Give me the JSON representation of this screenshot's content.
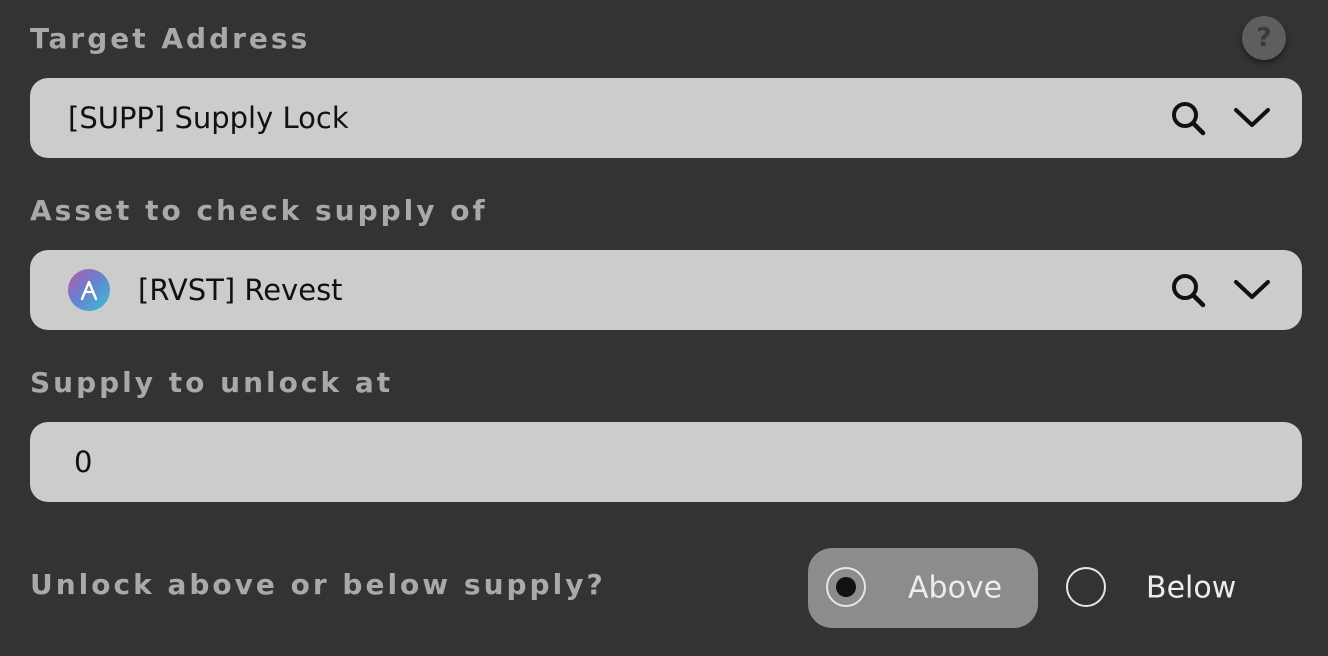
{
  "target_address": {
    "label": "Target Address",
    "value": "[SUPP] Supply Lock",
    "search_icon": "search-icon",
    "dropdown_icon": "chevron-down-icon"
  },
  "help": {
    "symbol": "?",
    "icon": "help-icon"
  },
  "asset": {
    "label": "Asset to check supply of",
    "value": "[RVST] Revest",
    "logo_icon": "revest-logo-icon",
    "search_icon": "search-icon",
    "dropdown_icon": "chevron-down-icon"
  },
  "supply": {
    "label": "Supply to unlock at",
    "value": "0"
  },
  "direction": {
    "question": "Unlock above or below supply?",
    "options": [
      {
        "label": "Above",
        "selected": true
      },
      {
        "label": "Below",
        "selected": false
      }
    ]
  },
  "colors": {
    "background": "#333333",
    "field": "#cccccc",
    "label": "#a9a9a9",
    "selected_option": "#8c8c8c"
  }
}
